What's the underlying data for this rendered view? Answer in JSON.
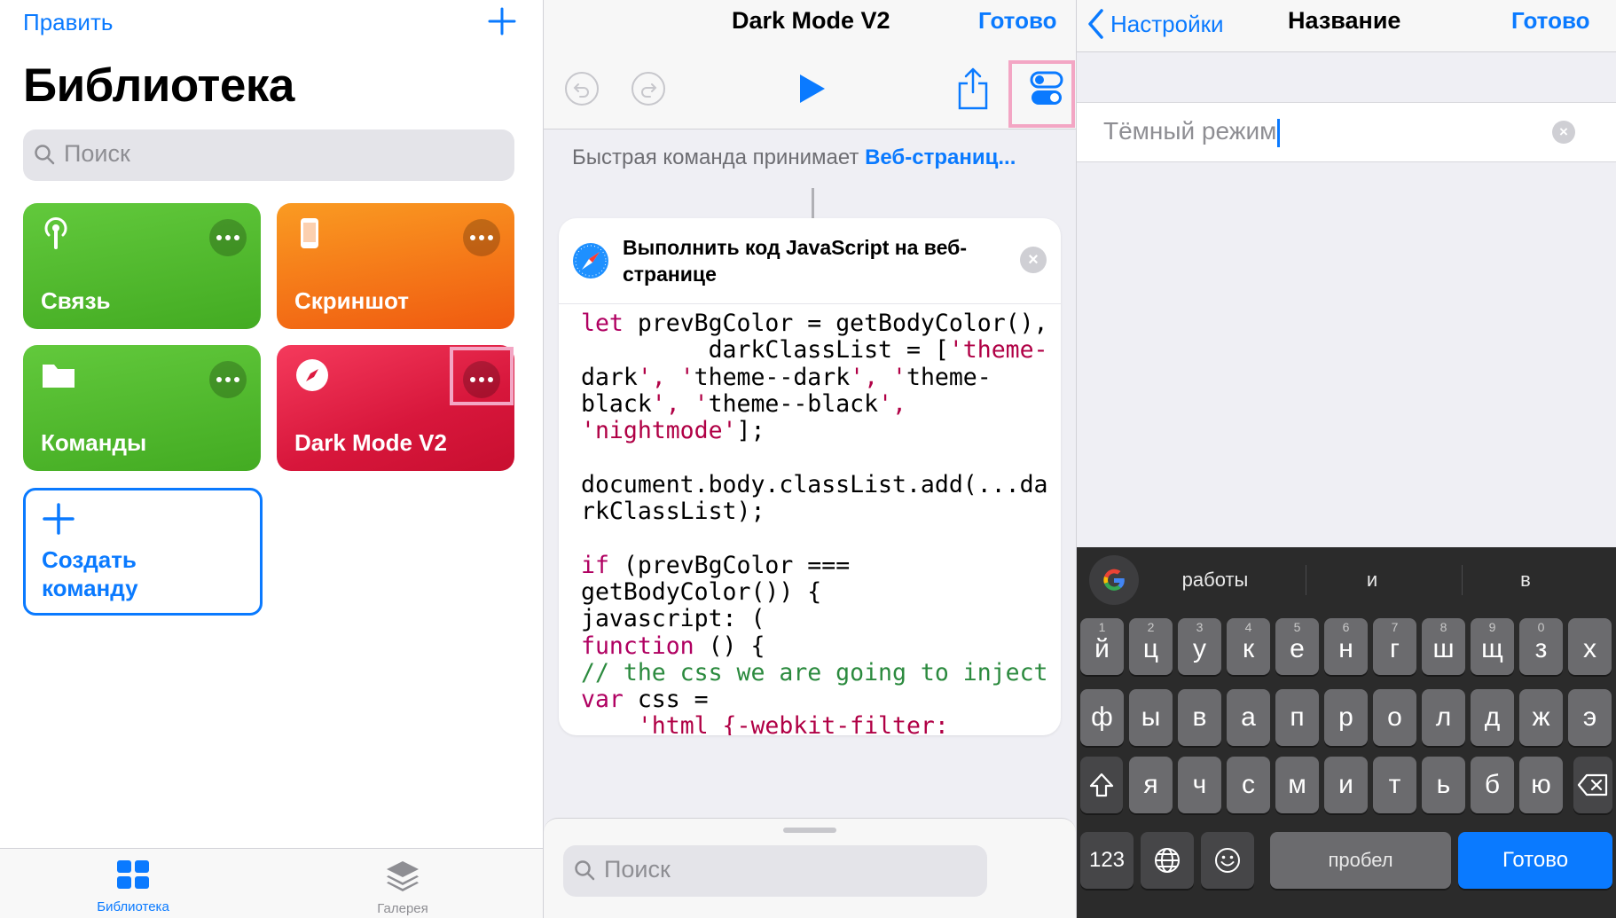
{
  "library": {
    "edit_label": "Править",
    "add_icon": "plus-icon",
    "title": "Библиотека",
    "search_placeholder": "Поиск",
    "shortcuts": [
      {
        "label": "Связь",
        "icon": "antenna-icon",
        "color": "#4fb82c"
      },
      {
        "label": "Скриншот",
        "icon": "phone-icon",
        "color": "#f5781a"
      },
      {
        "label": "Команды",
        "icon": "folder-icon",
        "color": "#4fb82c"
      },
      {
        "label": "Dark Mode V2",
        "icon": "compass-icon",
        "color": "#dc1b40"
      }
    ],
    "create_label": "Создать команду",
    "tabs": [
      {
        "label": "Библиотека",
        "icon": "grid-icon",
        "active": true
      },
      {
        "label": "Галерея",
        "icon": "layers-icon",
        "active": false
      }
    ]
  },
  "editor": {
    "title": "Dark Mode V2",
    "done_label": "Готово",
    "accepts_prefix": "Быстрая команда принимает ",
    "accepts_link": "Веб-страниц...",
    "action": {
      "title": "Выполнить код JavaScript на веб-странице",
      "icon": "safari-icon"
    },
    "code_lines": [
      "let prevBgColor = getBodyColor(),",
      "         darkClassList = ['theme-",
      "dark', 'theme--dark', 'theme-",
      "black', 'theme--black',",
      "'nightmode'];",
      "",
      "document.body.classList.add(...da",
      "rkClassList);",
      "",
      "if (prevBgColor ===",
      "getBodyColor()) {",
      "javascript: (",
      "function () {",
      "// the css we are going to inject",
      "var css =",
      "    'html {-webkit-filter:"
    ],
    "search_placeholder": "Поиск"
  },
  "settings": {
    "back_label": "Настройки",
    "title": "Название",
    "done_label": "Готово",
    "name_value": "Тёмный режим"
  },
  "keyboard": {
    "suggestions": [
      "работы",
      "и",
      "в"
    ],
    "row1": [
      {
        "ch": "й",
        "hint": "1"
      },
      {
        "ch": "ц",
        "hint": "2"
      },
      {
        "ch": "у",
        "hint": "3"
      },
      {
        "ch": "к",
        "hint": "4"
      },
      {
        "ch": "е",
        "hint": "5"
      },
      {
        "ch": "н",
        "hint": "6"
      },
      {
        "ch": "г",
        "hint": "7"
      },
      {
        "ch": "ш",
        "hint": "8"
      },
      {
        "ch": "щ",
        "hint": "9"
      },
      {
        "ch": "з",
        "hint": "0"
      },
      {
        "ch": "х",
        "hint": ""
      }
    ],
    "row2": [
      "ф",
      "ы",
      "в",
      "а",
      "п",
      "р",
      "о",
      "л",
      "д",
      "ж",
      "э"
    ],
    "row3": [
      "я",
      "ч",
      "с",
      "м",
      "и",
      "т",
      "ь",
      "б",
      "ю"
    ],
    "numbers_label": "123",
    "space_label": "пробел",
    "return_label": "Готово"
  },
  "colors": {
    "accent": "#0a7aff",
    "highlight": "#f3a6c4"
  }
}
